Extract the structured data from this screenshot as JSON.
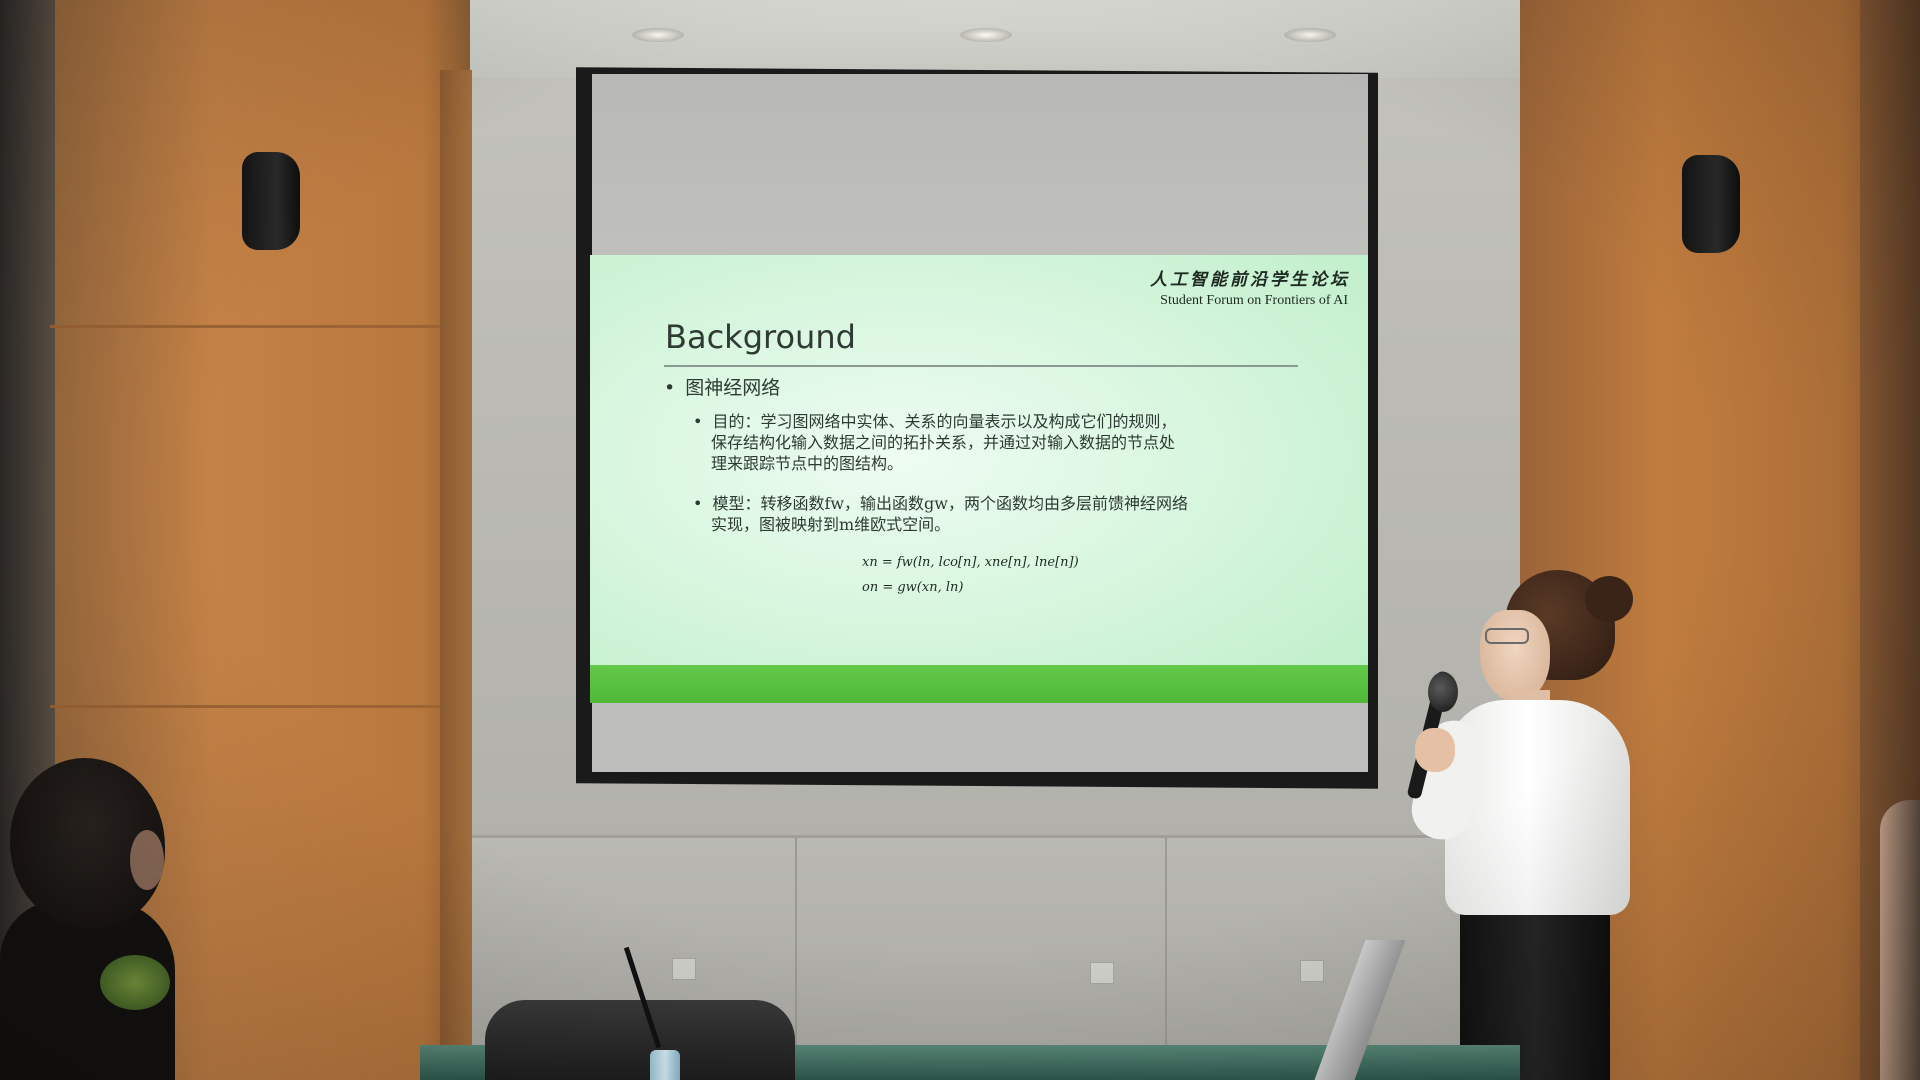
{
  "slide": {
    "logo_cn": "人工智能前沿学生论坛",
    "logo_en": "Student Forum on Frontiers of AI",
    "title": "Background",
    "bullet_main": "图神经网络",
    "bullet_goal_line1": "目的：学习图网络中实体、关系的向量表示以及构成它们的规则，",
    "bullet_goal_line2": "保存结构化输入数据之间的拓扑关系，并通过对输入数据的节点处",
    "bullet_goal_line3": "理来跟踪节点中的图结构。",
    "bullet_model_line1": "模型：转移函数fw，输出函数gw，两个函数均由多层前馈神经网络",
    "bullet_model_line2": "实现，图被映射到m维欧式空间。",
    "formula_1": "xn = fw(ln, lco[n], xne[n], lne[n])",
    "formula_2": "on = gw(xn, ln)"
  },
  "colors": {
    "slide_background": "#d8f6df",
    "slide_bar": "#55bd3c",
    "wall_wood": "#c07c3e"
  }
}
